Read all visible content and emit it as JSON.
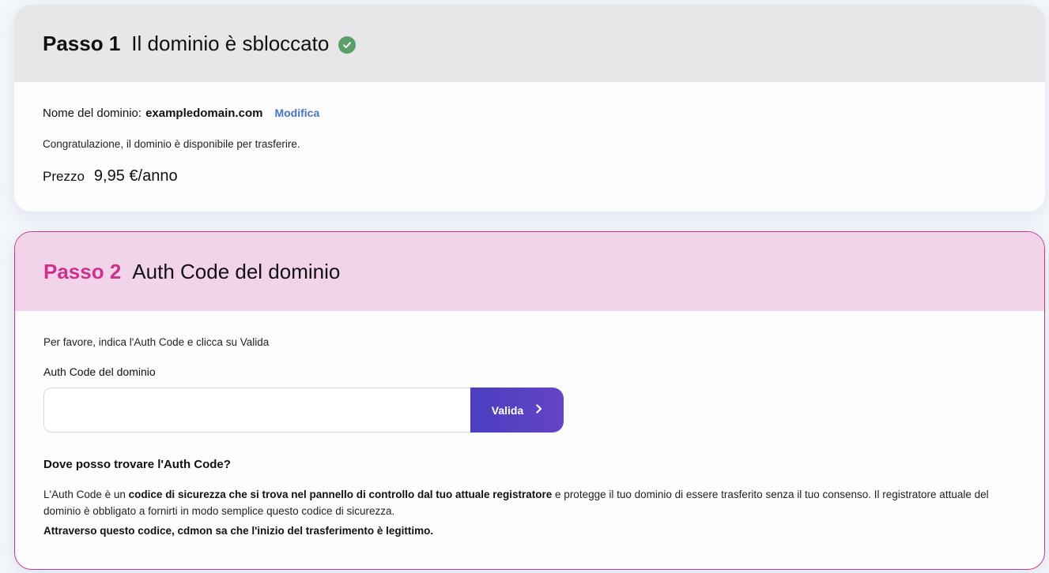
{
  "step1": {
    "number": "Passo 1",
    "title": "Il dominio è sbloccato",
    "status_icon": "check-circle-icon",
    "domain_label": "Nome del dominio:",
    "domain_value": "exampledomain.com",
    "edit_link": "Modifica",
    "congrats": "Congratulazione, il dominio è disponibile per trasferire.",
    "price_label": "Prezzo",
    "price_value": "9,95 €/anno"
  },
  "step2": {
    "number": "Passo 2",
    "title": "Auth Code del dominio",
    "instruction": "Per favore, indica l'Auth Code e clicca su Valida",
    "field_label": "Auth Code del dominio",
    "input_value": "",
    "button_label": "Valida",
    "button_icon": "chevron-right-icon",
    "faq_title": "Dove posso trovare l'Auth Code?",
    "faq_text_pre": "L'Auth Code è un ",
    "faq_text_bold": "codice di sicurezza che si trova nel pannello di controllo dal tuo attuale registratore",
    "faq_text_post": " e protegge il tuo dominio di essere trasferito senza il tuo consenso. Il registratore attuale del dominio è obbligato a fornirti in modo semplice questo codice di sicurezza.",
    "faq_strong": "Attraverso questo codice, cdmon sa che l'inizio del trasferimento è legittimo."
  },
  "colors": {
    "accent_pink": "#cf2f8f",
    "button_purple": "#5541c3",
    "link_blue": "#4a72c8",
    "success_green": "#5a9e6a"
  }
}
